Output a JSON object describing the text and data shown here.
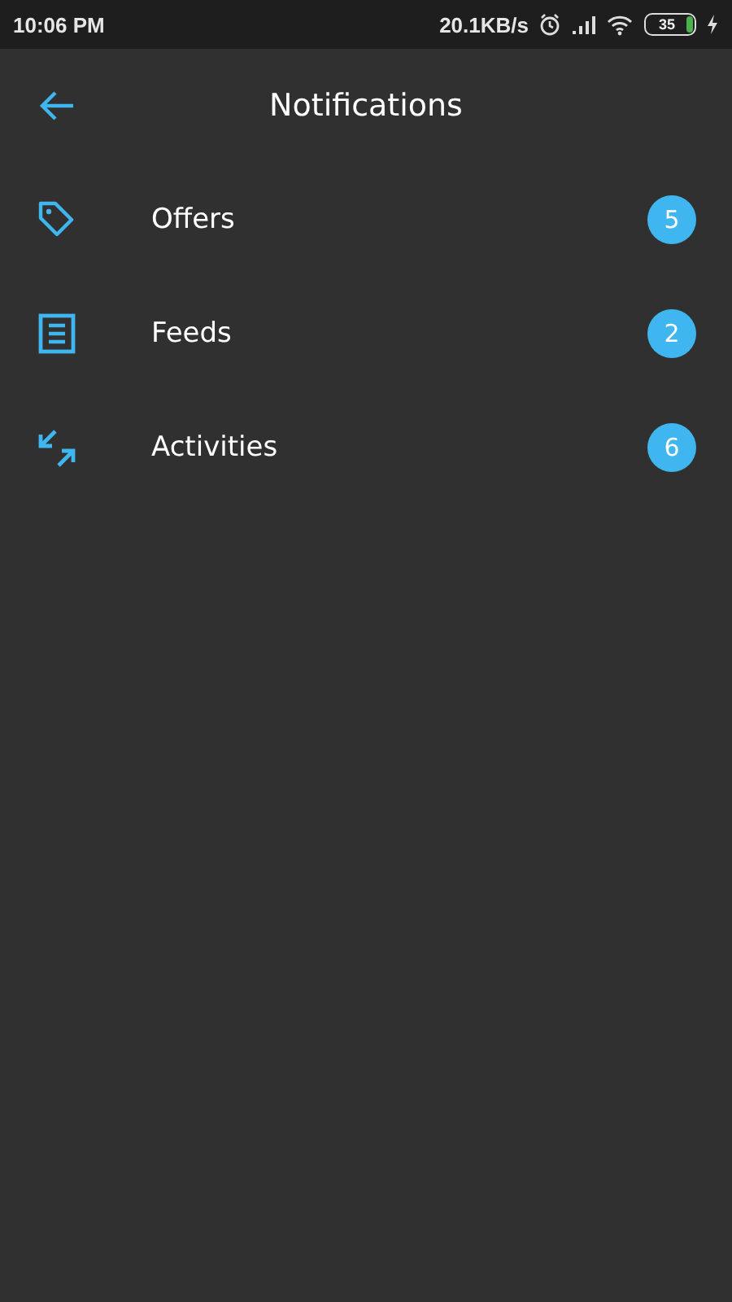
{
  "status_bar": {
    "time": "10:06 PM",
    "speed": "20.1KB/s",
    "battery": "35"
  },
  "header": {
    "title": "Notifications"
  },
  "items": [
    {
      "kind": "tag",
      "label": "Offers",
      "count": "5"
    },
    {
      "kind": "list",
      "label": "Feeds",
      "count": "2"
    },
    {
      "kind": "swap",
      "label": "Activities",
      "count": "6"
    }
  ]
}
